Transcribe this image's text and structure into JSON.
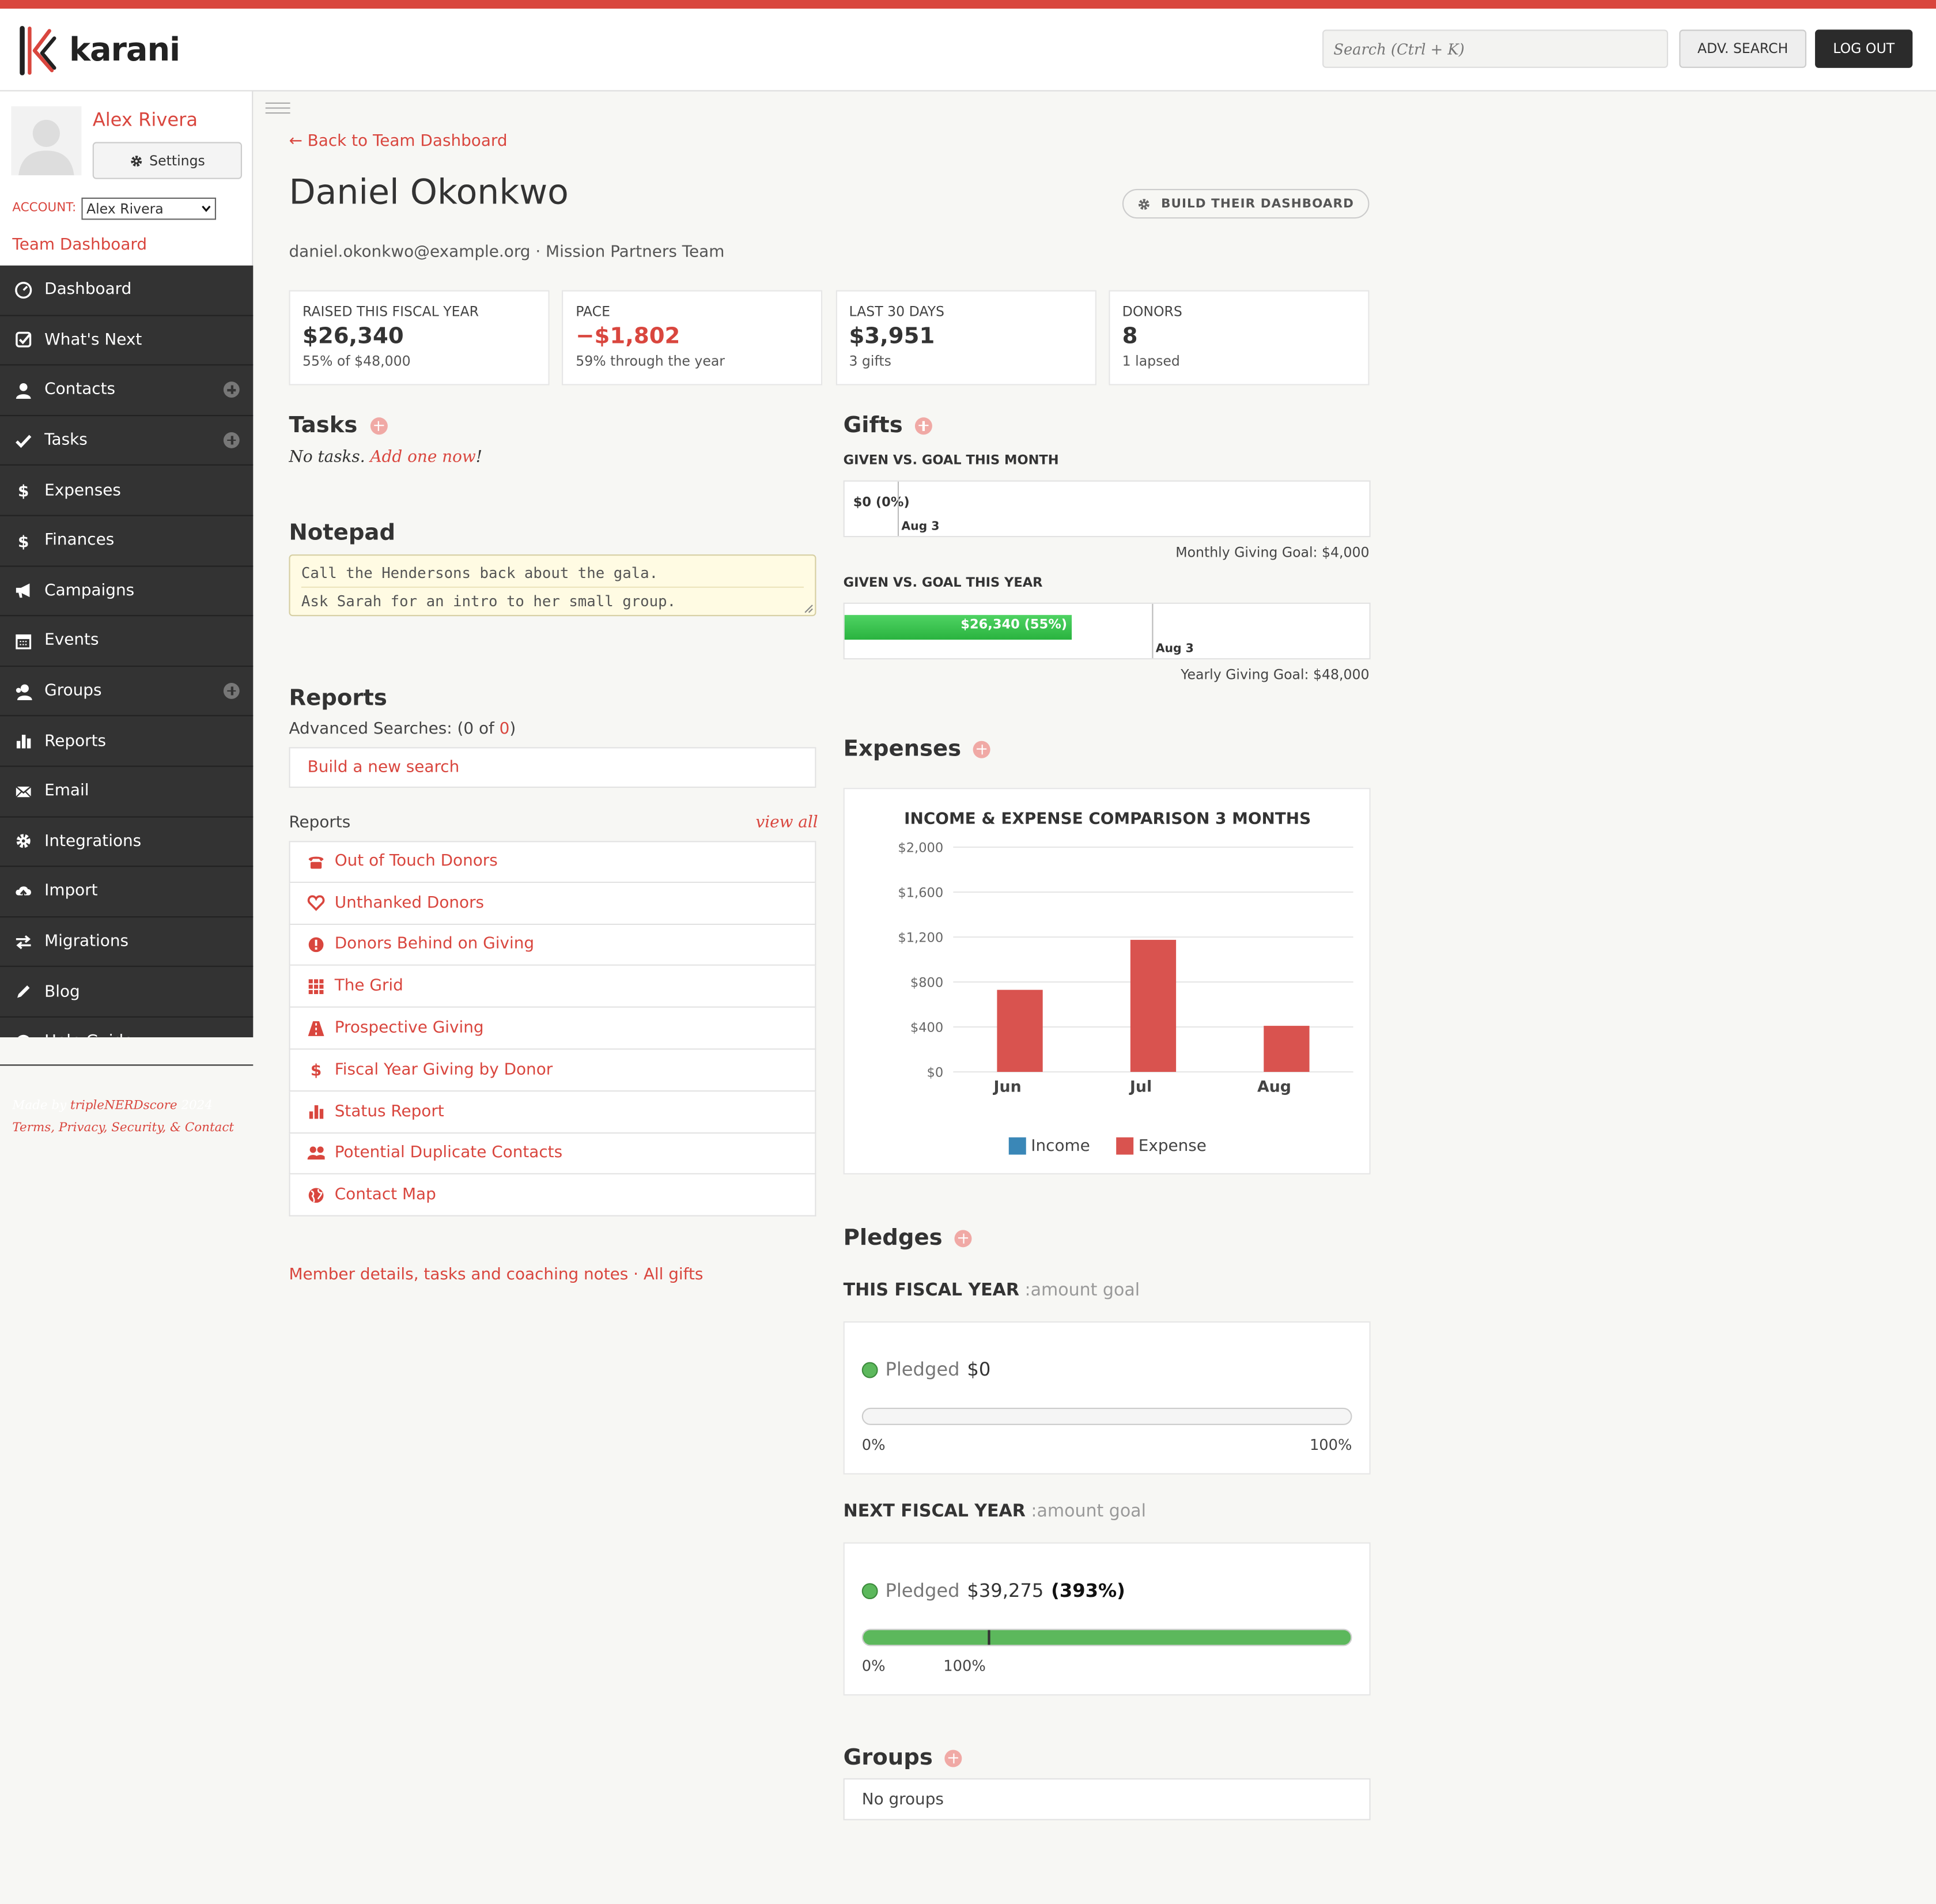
{
  "app": {
    "logo_text": "karani",
    "accent": "#d9463e"
  },
  "header": {
    "search_placeholder": "Search (Ctrl + K)",
    "adv_search": "ADV. SEARCH",
    "logout": "LOG OUT"
  },
  "user": {
    "name": "Alex Rivera",
    "settings": "Settings",
    "account_label": "ACCOUNT:",
    "account_value": "Alex Rivera",
    "team_dashboard": "Team Dashboard"
  },
  "nav": [
    {
      "label": "Dashboard",
      "icon": "dashboard-icon",
      "plus": false
    },
    {
      "label": "What's Next",
      "icon": "check-square-icon",
      "plus": false
    },
    {
      "label": "Contacts",
      "icon": "user-icon",
      "plus": true
    },
    {
      "label": "Tasks",
      "icon": "check-icon",
      "plus": true
    },
    {
      "label": "Expenses",
      "icon": "dollar-icon",
      "plus": false
    },
    {
      "label": "Finances",
      "icon": "dollar-icon",
      "plus": false
    },
    {
      "label": "Campaigns",
      "icon": "bullhorn-icon",
      "plus": false
    },
    {
      "label": "Events",
      "icon": "calendar-icon",
      "plus": false
    },
    {
      "label": "Groups",
      "icon": "group-icon",
      "plus": true
    },
    {
      "label": "Reports",
      "icon": "bar-chart-icon",
      "plus": false
    },
    {
      "label": "Email",
      "icon": "envelope-icon",
      "plus": false
    },
    {
      "label": "Integrations",
      "icon": "gear-icon",
      "plus": false
    },
    {
      "label": "Import",
      "icon": "cloud-upload-icon",
      "plus": false
    },
    {
      "label": "Migrations",
      "icon": "exchange-icon",
      "plus": false
    },
    {
      "label": "Blog",
      "icon": "pencil-icon",
      "plus": false
    },
    {
      "label": "Help Guide",
      "icon": "question-icon",
      "plus": false
    }
  ],
  "footer": {
    "made_by": "Made by",
    "company": "tripleNERDscore",
    "year": "2024",
    "legal": "Terms, Privacy, Security, & Contact"
  },
  "page": {
    "back_link": "← Back to Team Dashboard",
    "title": "Daniel Okonkwo",
    "build_button": "BUILD THEIR DASHBOARD",
    "subinfo": "daniel.okonkwo@example.org · Mission Partners Team"
  },
  "stats": [
    {
      "label": "RAISED THIS FISCAL YEAR",
      "value": "$26,340",
      "sub": "55% of $48,000",
      "red": false
    },
    {
      "label": "PACE",
      "value": "−$1,802",
      "sub": "59% through the year",
      "red": true
    },
    {
      "label": "LAST 30 DAYS",
      "value": "$3,951",
      "sub": "3 gifts",
      "red": false
    },
    {
      "label": "DONORS",
      "value": "8",
      "sub": "1 lapsed",
      "red": false
    }
  ],
  "tasks": {
    "title": "Tasks",
    "empty_prefix": "No tasks.",
    "empty_link": "Add one now",
    "empty_suffix": "!"
  },
  "notepad": {
    "title": "Notepad",
    "line1": "Call the Hendersons back about the gala.",
    "line2": "Ask Sarah for an intro to her small group."
  },
  "reports": {
    "title": "Reports",
    "adv_prefix": "Advanced Searches: (0 of ",
    "adv_link": "0",
    "adv_suffix": ")",
    "build_search": "Build a new search",
    "list_label": "Reports",
    "view_all": "view all",
    "items": [
      {
        "label": "Out of Touch Donors",
        "icon": "phone-icon"
      },
      {
        "label": "Unthanked Donors",
        "icon": "heart-icon"
      },
      {
        "label": "Donors Behind on Giving",
        "icon": "exclamation-icon"
      },
      {
        "label": "The Grid",
        "icon": "grid-icon"
      },
      {
        "label": "Prospective Giving",
        "icon": "road-icon"
      },
      {
        "label": "Fiscal Year Giving by Donor",
        "icon": "dollar-icon"
      },
      {
        "label": "Status Report",
        "icon": "bar-chart-icon"
      },
      {
        "label": "Potential Duplicate Contacts",
        "icon": "users-icon"
      },
      {
        "label": "Contact Map",
        "icon": "globe-icon"
      }
    ],
    "member_links": "Member details, tasks and coaching notes · All gifts"
  },
  "gifts": {
    "title": "Gifts",
    "month_title": "GIVEN VS. GOAL THIS MONTH",
    "month_value": "$0 (0%)",
    "month_progress": 0,
    "month_today_fraction": 0.1,
    "month_today": "Aug 3",
    "month_goal": "Monthly Giving Goal: $4,000",
    "year_title": "GIVEN VS. GOAL THIS YEAR",
    "year_value": "$26,340 (55%)",
    "year_progress": 0.55,
    "year_today_fraction": 0.585,
    "year_today": "Aug 3",
    "year_goal": "Yearly Giving Goal: $48,000"
  },
  "expenses": {
    "title": "Expenses"
  },
  "chart_data": {
    "type": "bar",
    "title": "INCOME & EXPENSE COMPARISON 3 MONTHS",
    "categories": [
      "Jun",
      "Jul",
      "Aug"
    ],
    "series": [
      {
        "name": "Income",
        "values": [
          0,
          0,
          0
        ],
        "color": "#3a87b7"
      },
      {
        "name": "Expense",
        "values": [
          730,
          1175,
          410
        ],
        "color": "#d9534f"
      }
    ],
    "ylim": [
      0,
      2000
    ],
    "yticks": [
      0,
      400,
      800,
      1200,
      1600,
      2000
    ],
    "ytick_labels": [
      "$0",
      "$400",
      "$800",
      "$1,200",
      "$1,600",
      "$2,000"
    ],
    "grid": true,
    "legend": "bottom"
  },
  "pledges": {
    "title": "Pledges",
    "this_year": {
      "heading": "THIS FISCAL YEAR",
      "suffix": " :amount goal",
      "label": "Pledged",
      "amount": "$0",
      "pct": "",
      "progress": 0,
      "marker": null,
      "left": "0%",
      "right": "100%"
    },
    "next_year": {
      "heading": "NEXT FISCAL YEAR",
      "suffix": " :amount goal",
      "label": "Pledged",
      "amount": "$39,275",
      "pct": "(393%)",
      "progress": 1,
      "marker": 0.2545,
      "left": "0%",
      "right": "100%"
    }
  },
  "groups": {
    "title": "Groups",
    "empty": "No groups"
  }
}
